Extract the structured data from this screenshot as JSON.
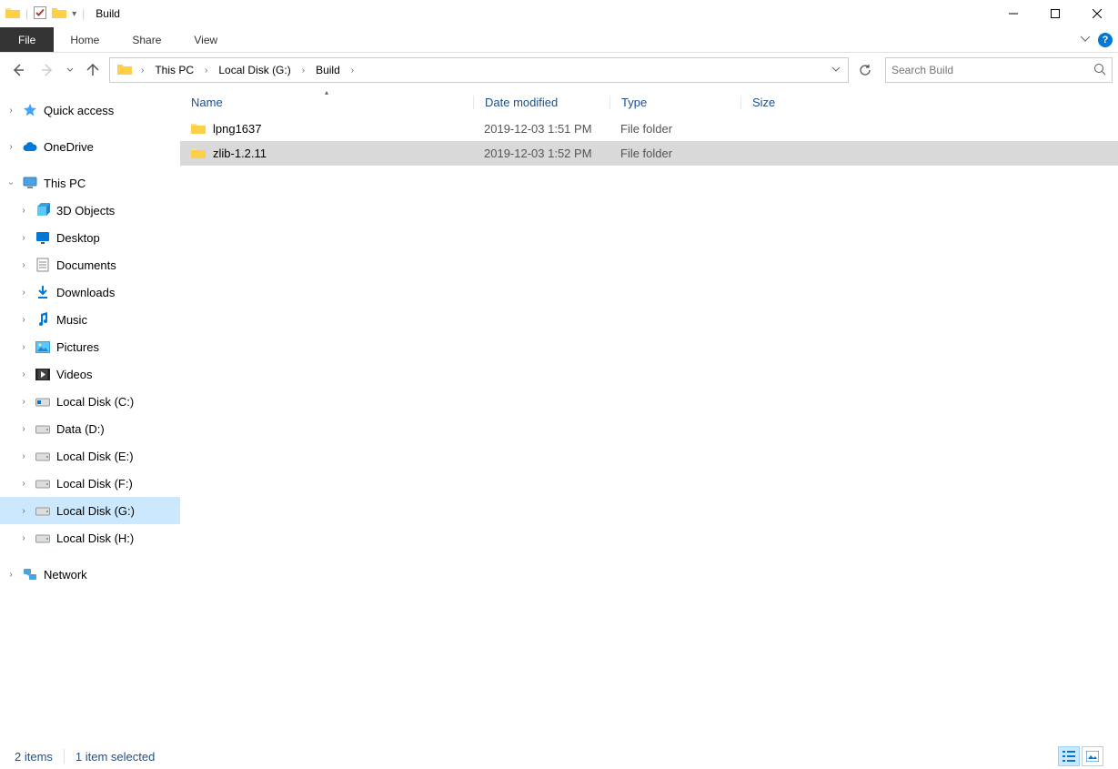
{
  "window": {
    "title": "Build"
  },
  "ribbon": {
    "file": "File",
    "tabs": [
      "Home",
      "Share",
      "View"
    ]
  },
  "breadcrumb": {
    "items": [
      "This PC",
      "Local Disk (G:)",
      "Build"
    ]
  },
  "search": {
    "placeholder": "Search Build"
  },
  "sidebar": {
    "quickaccess": "Quick access",
    "onedrive": "OneDrive",
    "thispc": "This PC",
    "thispc_children": [
      {
        "label": "3D Objects",
        "icon": "3d"
      },
      {
        "label": "Desktop",
        "icon": "desktop"
      },
      {
        "label": "Documents",
        "icon": "documents"
      },
      {
        "label": "Downloads",
        "icon": "downloads"
      },
      {
        "label": "Music",
        "icon": "music"
      },
      {
        "label": "Pictures",
        "icon": "pictures"
      },
      {
        "label": "Videos",
        "icon": "videos"
      },
      {
        "label": "Local Disk (C:)",
        "icon": "drive-win"
      },
      {
        "label": "Data (D:)",
        "icon": "drive"
      },
      {
        "label": "Local Disk (E:)",
        "icon": "drive"
      },
      {
        "label": "Local Disk (F:)",
        "icon": "drive"
      },
      {
        "label": "Local Disk (G:)",
        "icon": "drive",
        "selected": true
      },
      {
        "label": "Local Disk (H:)",
        "icon": "drive"
      }
    ],
    "network": "Network"
  },
  "columns": {
    "name": "Name",
    "date": "Date modified",
    "type": "Type",
    "size": "Size"
  },
  "files": [
    {
      "name": "lpng1637",
      "date": "2019-12-03 1:51 PM",
      "type": "File folder",
      "size": "",
      "selected": false
    },
    {
      "name": "zlib-1.2.11",
      "date": "2019-12-03 1:52 PM",
      "type": "File folder",
      "size": "",
      "selected": true
    }
  ],
  "status": {
    "count": "2 items",
    "selection": "1 item selected"
  }
}
